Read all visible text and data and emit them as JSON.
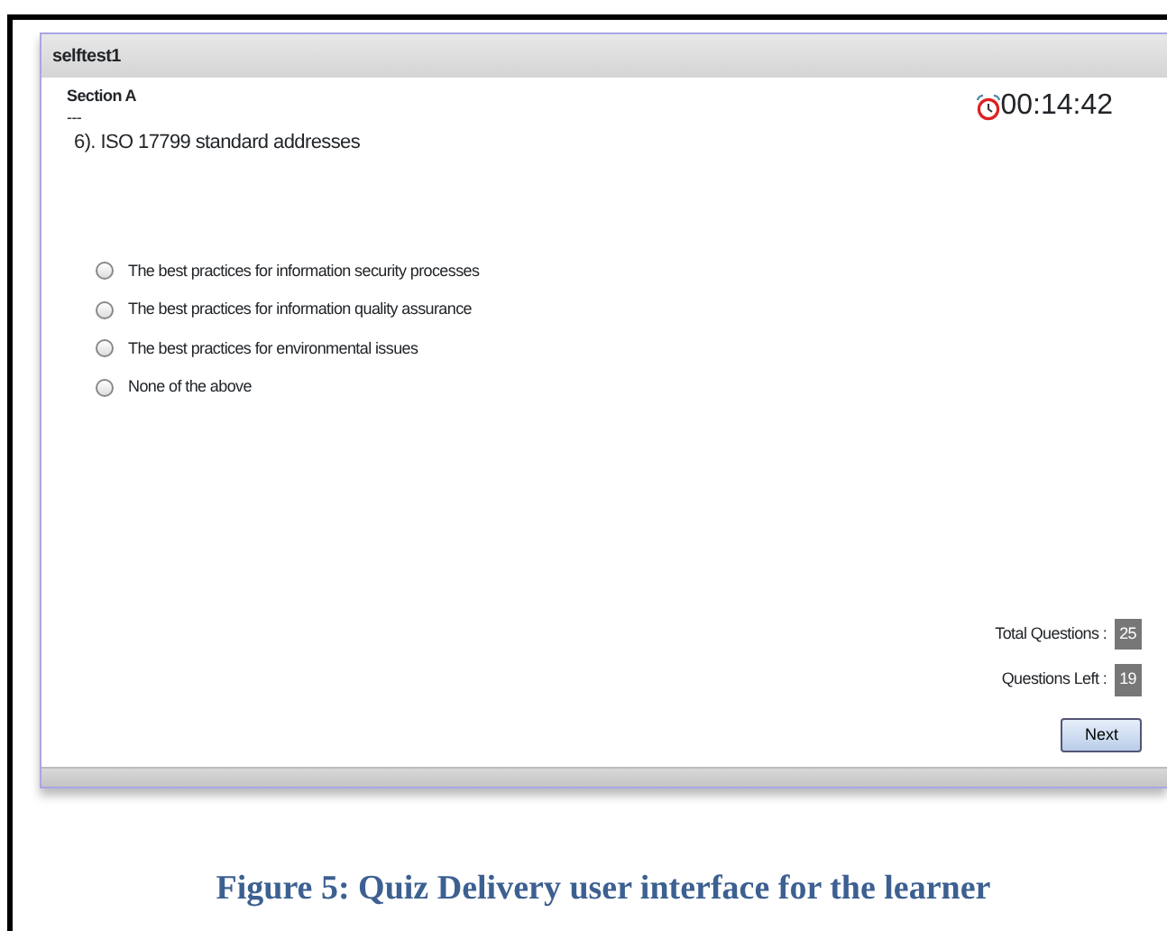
{
  "window": {
    "title": "selftest1"
  },
  "section": {
    "title": "Section A",
    "subtitle": "---"
  },
  "timer": "00:14:42",
  "question": "6). ISO 17799 standard addresses",
  "options": [
    {
      "label": "The best practices for information security processes",
      "selected": false
    },
    {
      "label": "The best practices for information quality assurance",
      "selected": false
    },
    {
      "label": "The best practices for environmental issues",
      "selected": false
    },
    {
      "label": "None of the above",
      "selected": false
    }
  ],
  "stats": [
    {
      "label": "Total Questions :",
      "value": "25"
    },
    {
      "label": "Questions Left :",
      "value": "19"
    }
  ],
  "buttons": [
    "Next"
  ],
  "caption": "Figure 5: Quiz Delivery user interface for the learner"
}
